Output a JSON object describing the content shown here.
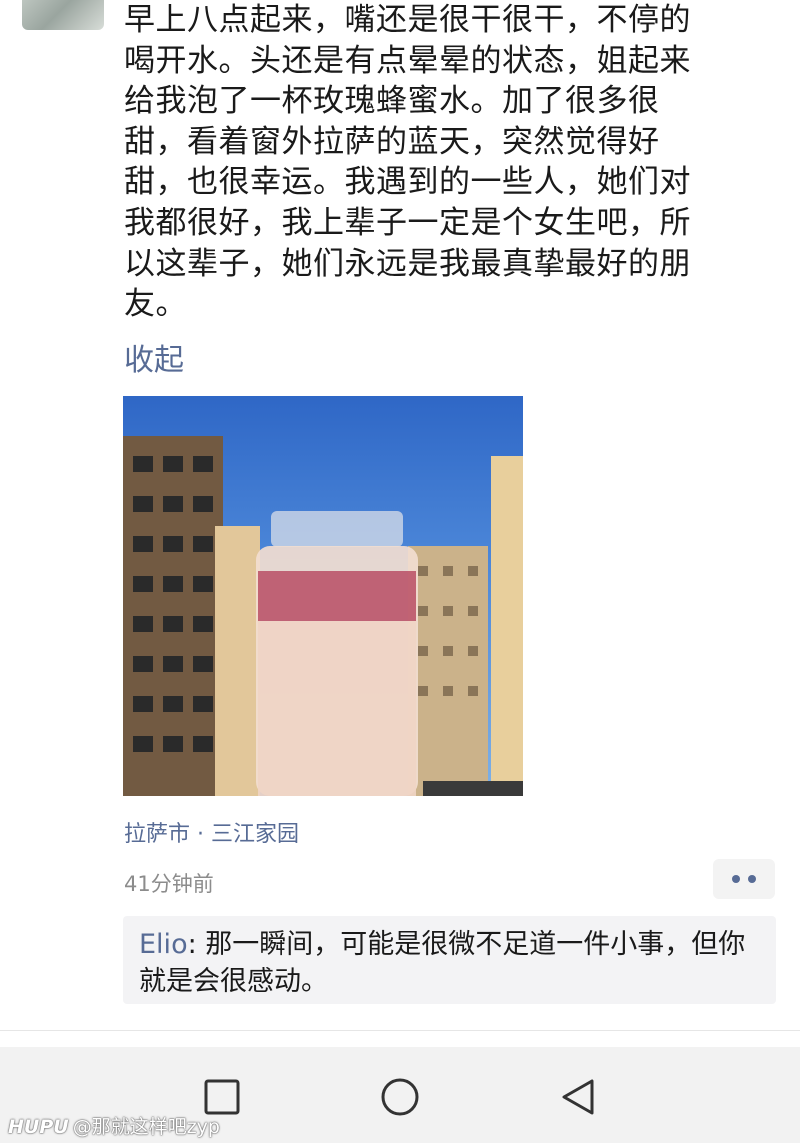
{
  "post": {
    "text": "早上八点起来，嘴还是很干很干，不停的\n喝开水。头还是有点晕晕的状态，姐起来\n给我泡了一杯玫瑰蜂蜜水。加了很多很\n甜，看着窗外拉萨的蓝天，突然觉得好\n甜，也很幸运。我遇到的一些人，她们对\n我都很好，我上辈子一定是个女生吧，所\n以这辈子，她们永远是我最真挚最好的朋\n友。",
    "collapse_label": "收起",
    "location": "拉萨市 · 三江家园",
    "time": "41分钟前"
  },
  "comment": {
    "author": "Elio",
    "separator": ": ",
    "text": "那一瞬间，可能是很微不足道一件小事，但你就是会很感动。"
  },
  "watermark": {
    "brand": "HUPU",
    "handle": "@那就这样吧zyp"
  },
  "colors": {
    "link": "#576b95",
    "meta": "#8c8c8c",
    "sky": "#2f67c6"
  },
  "icons": {
    "more": "two-dots-icon",
    "recent": "square-icon",
    "home": "circle-icon",
    "back": "triangle-back-icon"
  }
}
